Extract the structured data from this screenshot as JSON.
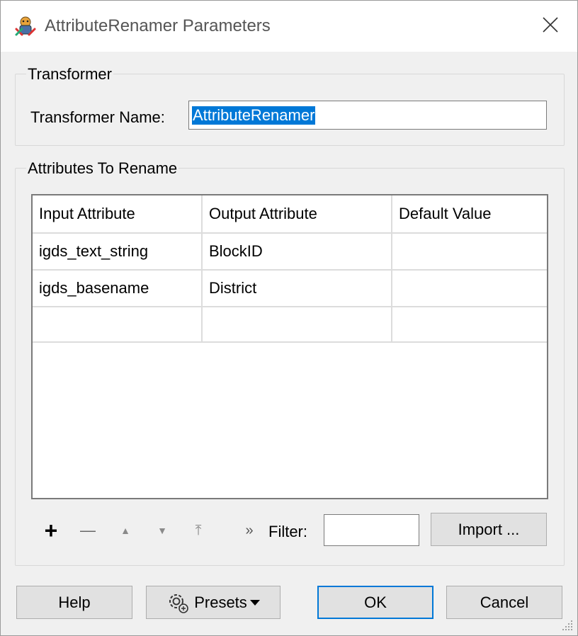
{
  "window": {
    "title": "AttributeRenamer Parameters"
  },
  "transformer_group": {
    "label": "Transformer",
    "name_label": "Transformer Name:",
    "name_value": "AttributeRenamer"
  },
  "attributes_group": {
    "label": "Attributes To Rename",
    "columns": [
      "Input Attribute",
      "Output Attribute",
      "Default Value"
    ],
    "rows": [
      [
        "igds_text_string",
        "BlockID",
        ""
      ],
      [
        "igds_basename",
        "District",
        ""
      ],
      [
        "",
        "",
        ""
      ]
    ]
  },
  "toolbar": {
    "add": "+",
    "remove": "—",
    "move_up": "▲",
    "move_down": "▼",
    "move_top": "⤒",
    "more": "»",
    "filter_label": "Filter:",
    "filter_value": "",
    "import_label": "Import ..."
  },
  "footer": {
    "help_label": "Help",
    "presets_label": "Presets",
    "ok_label": "OK",
    "cancel_label": "Cancel"
  },
  "colors": {
    "selection": "#0078d7",
    "ok_border": "#0078d7",
    "button_bg": "#e1e1e1"
  }
}
